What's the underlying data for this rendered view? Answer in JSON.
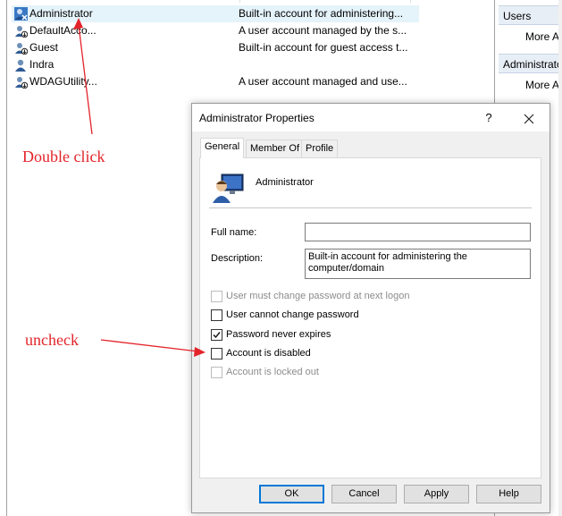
{
  "users_list": {
    "rows": [
      {
        "name": "Administrator",
        "description": "Built-in account for administering..."
      },
      {
        "name": "DefaultAcco...",
        "description": "A user account managed by the s..."
      },
      {
        "name": "Guest",
        "description": "Built-in account for guest access t..."
      },
      {
        "name": "Indra",
        "description": ""
      },
      {
        "name": "WDAGUtility...",
        "description": "A user account managed and use..."
      }
    ]
  },
  "actions_pane": {
    "section1": {
      "header": "Users",
      "more": "More Ac"
    },
    "section2": {
      "header": "Administrator",
      "more": "More Ac"
    }
  },
  "dialog": {
    "title": "Administrator Properties",
    "help_glyph": "?",
    "close_glyph": "✕",
    "tabs": [
      {
        "label": "General",
        "active": true
      },
      {
        "label": "Member Of",
        "active": false
      },
      {
        "label": "Profile",
        "active": false
      }
    ],
    "user_heading": "Administrator",
    "full_name": {
      "label": "Full name:",
      "value": ""
    },
    "description": {
      "label": "Description:",
      "value": "Built-in account for administering the computer/domain"
    },
    "checkboxes": [
      {
        "label": "User must change password at next logon",
        "checked": false,
        "enabled": false
      },
      {
        "label": "User cannot change password",
        "checked": false,
        "enabled": true
      },
      {
        "label": "Password never expires",
        "checked": true,
        "enabled": true
      },
      {
        "label": "Account is disabled",
        "checked": false,
        "enabled": true
      },
      {
        "label": "Account is locked out",
        "checked": false,
        "enabled": false
      }
    ],
    "buttons": {
      "ok": "OK",
      "cancel": "Cancel",
      "apply": "Apply",
      "help": "Help"
    }
  },
  "annotations": {
    "double_click": "Double click",
    "uncheck": "uncheck",
    "color": "#e3242b"
  }
}
